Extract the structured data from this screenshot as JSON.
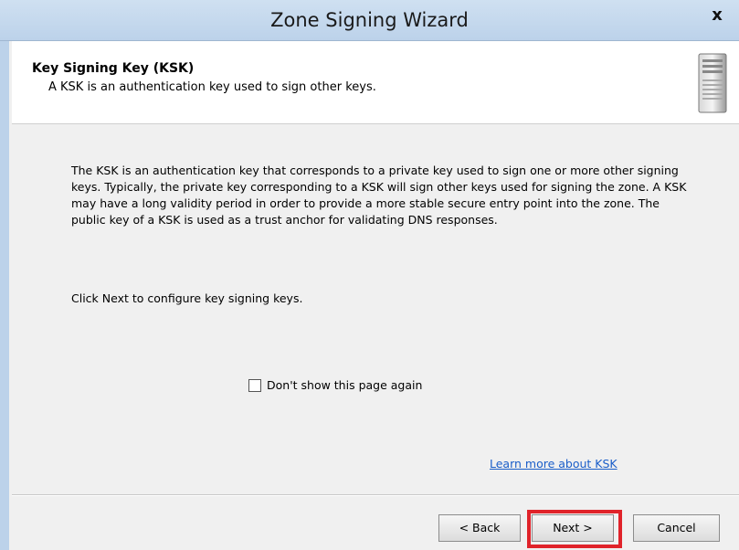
{
  "window": {
    "title": "Zone Signing Wizard",
    "close_label": "x"
  },
  "header": {
    "title": "Key Signing Key (KSK)",
    "description": "A KSK is an authentication key used to sign other keys.",
    "icon": "server-icon"
  },
  "body": {
    "paragraph": "The KSK is an authentication key that corresponds to a private key used to sign one or more other signing keys. Typically, the private key corresponding to a KSK will sign other keys used for signing the zone. A KSK may have a long validity period in order to provide a more stable secure entry point into the zone. The public key of a KSK is used as a trust anchor for validating DNS responses.",
    "instruction": "Click Next to configure key signing keys.",
    "checkbox_label": "Don't show this page again",
    "checkbox_checked": false,
    "learn_more_link": "Learn more about KSK"
  },
  "footer": {
    "back_label": "< Back",
    "next_label": "Next >",
    "cancel_label": "Cancel"
  },
  "colors": {
    "highlight": "#e0232a",
    "link": "#1a5ec9",
    "titlebar": "#bcd2ea"
  }
}
